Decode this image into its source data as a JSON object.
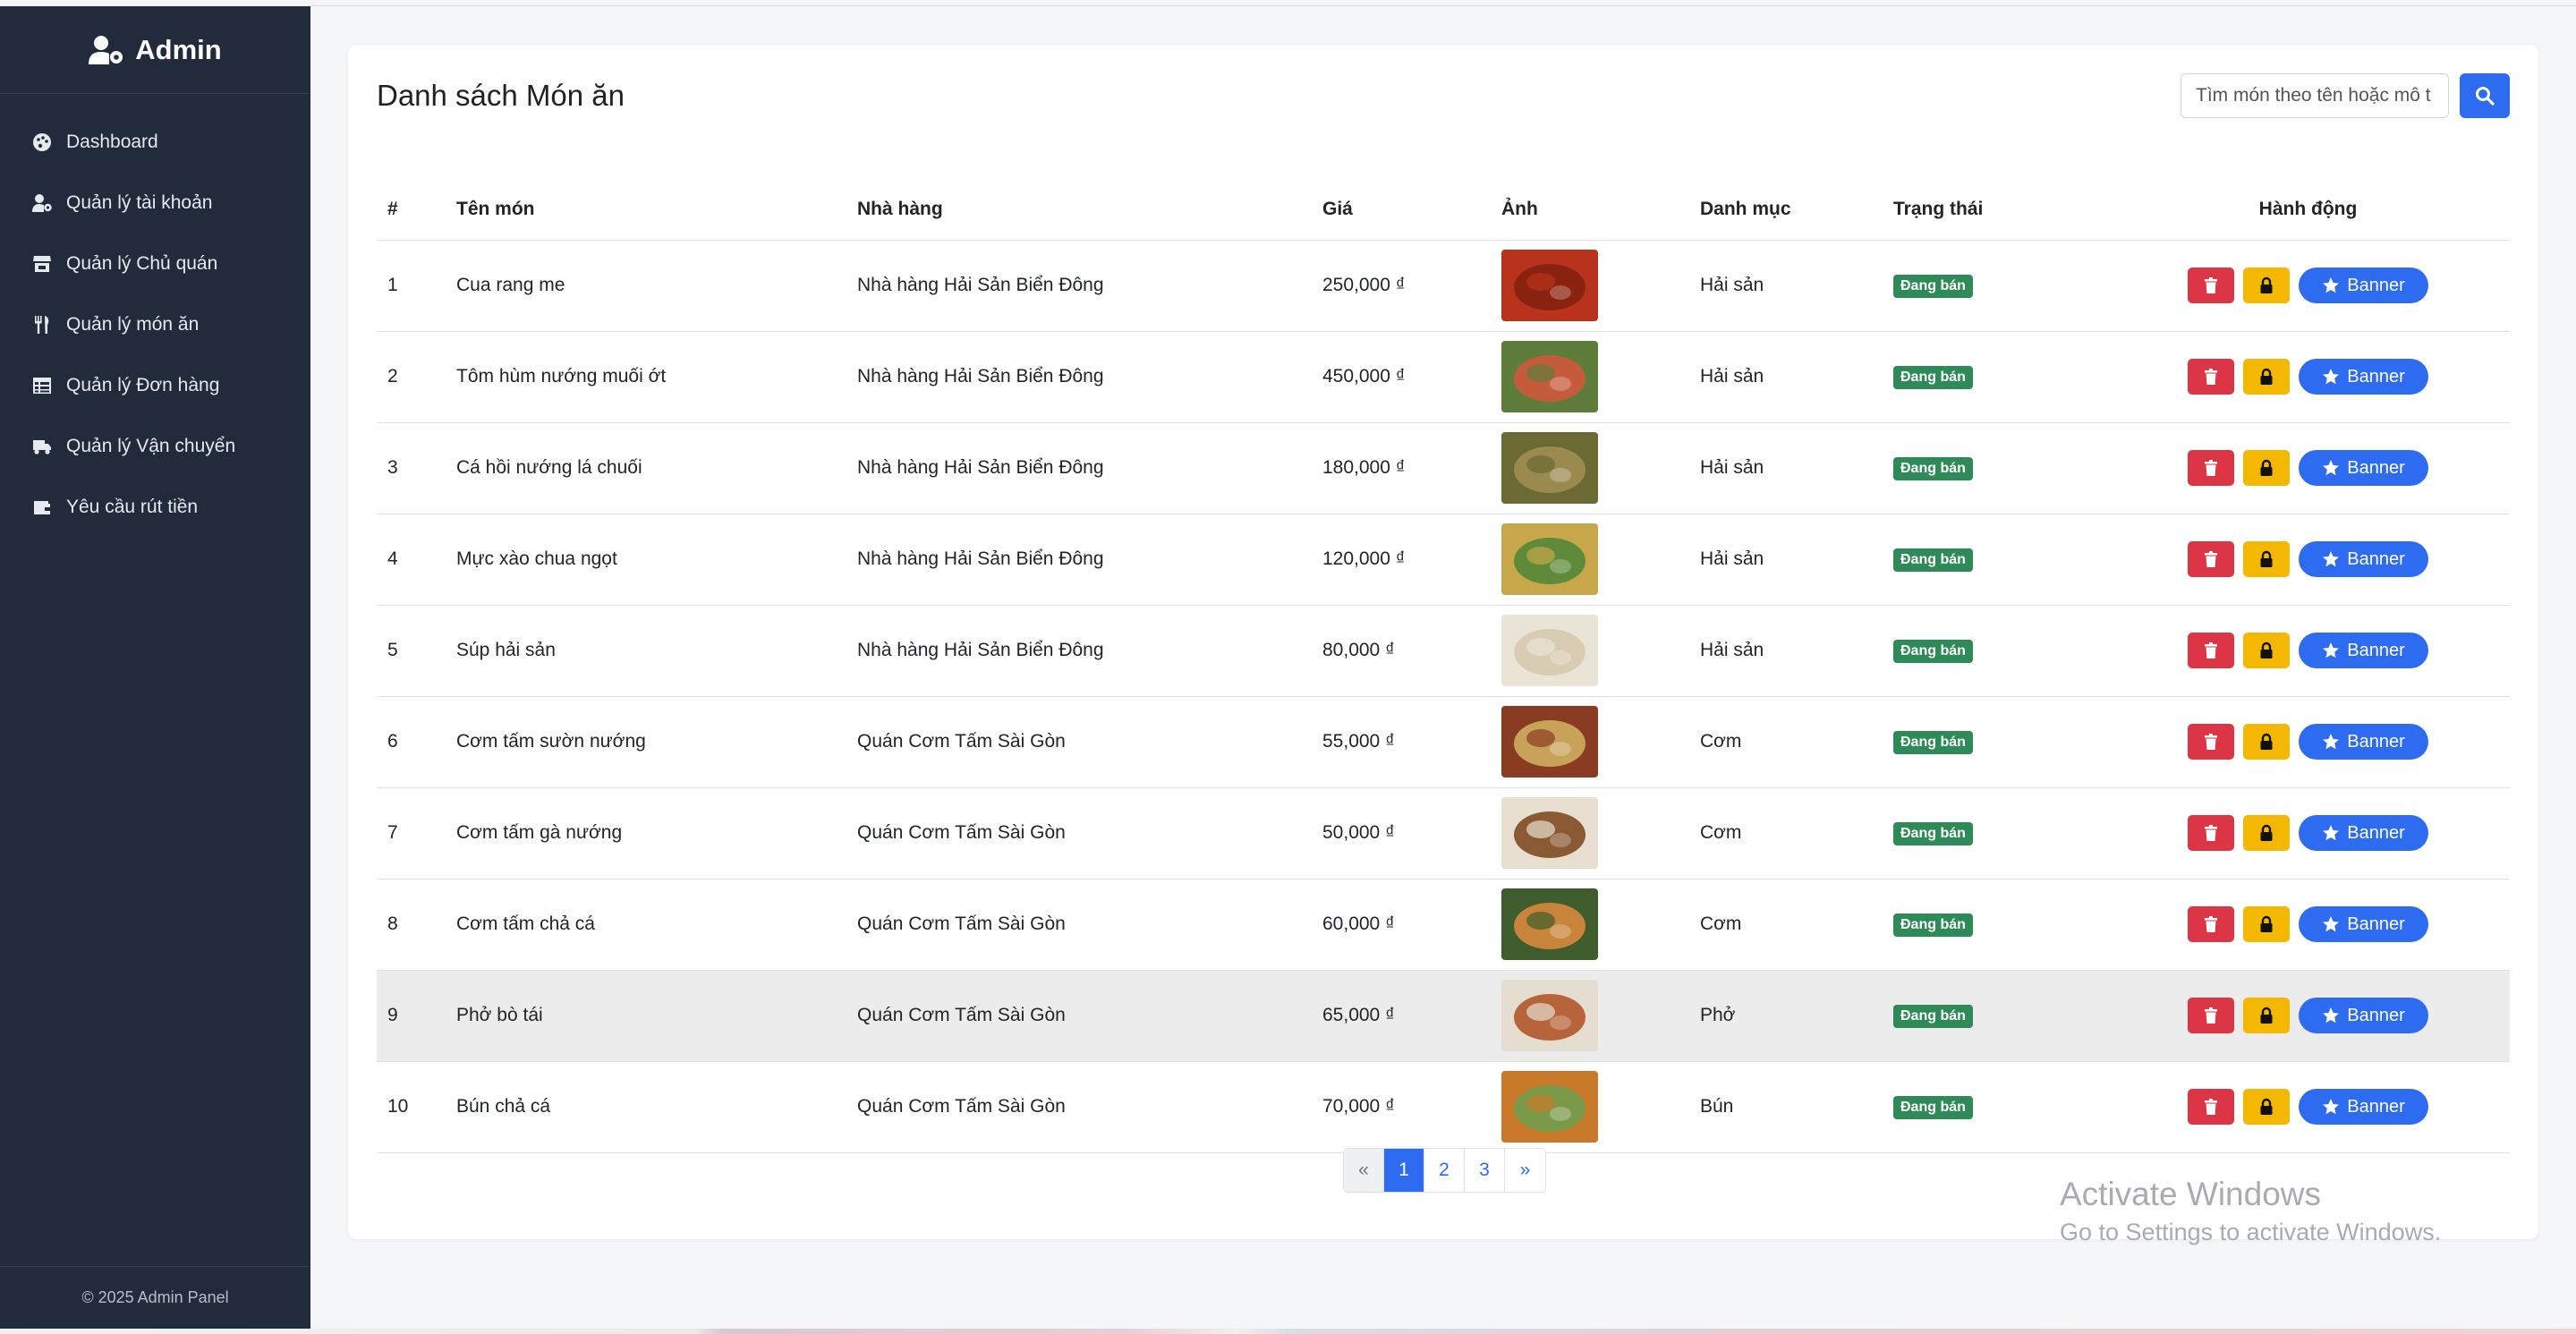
{
  "sidebar": {
    "brand": "Admin",
    "items": [
      {
        "label": "Dashboard",
        "icon": "palette-icon"
      },
      {
        "label": "Quản lý tài khoản",
        "icon": "user-gear-icon"
      },
      {
        "label": "Quản lý Chủ quán",
        "icon": "store-icon"
      },
      {
        "label": "Quản lý món ăn",
        "icon": "utensils-icon"
      },
      {
        "label": "Quản lý Đơn hàng",
        "icon": "table-list-icon"
      },
      {
        "label": "Quản lý Vận chuyển",
        "icon": "truck-icon"
      },
      {
        "label": "Yêu cầu rút tiền",
        "icon": "wallet-icon"
      }
    ],
    "footer": "© 2025 Admin Panel"
  },
  "main": {
    "title": "Danh sách Món ăn",
    "search_placeholder": "Tìm món theo tên hoặc mô t",
    "columns": [
      "#",
      "Tên món",
      "Nhà hàng",
      "Giá",
      "Ảnh",
      "Danh mục",
      "Trạng thái",
      "Hành động"
    ],
    "rows": [
      {
        "no": "1",
        "name": "Cua rang me",
        "restaurant": "Nhà hàng Hải Sản Biển Đông",
        "price": "250,000 ₫",
        "category": "Hải sản",
        "status": "Đang bán"
      },
      {
        "no": "2",
        "name": "Tôm hùm nướng muối ớt",
        "restaurant": "Nhà hàng Hải Sản Biển Đông",
        "price": "450,000 ₫",
        "category": "Hải sản",
        "status": "Đang bán"
      },
      {
        "no": "3",
        "name": "Cá hồi nướng lá chuối",
        "restaurant": "Nhà hàng Hải Sản Biển Đông",
        "price": "180,000 ₫",
        "category": "Hải sản",
        "status": "Đang bán"
      },
      {
        "no": "4",
        "name": "Mực xào chua ngọt",
        "restaurant": "Nhà hàng Hải Sản Biển Đông",
        "price": "120,000 ₫",
        "category": "Hải sản",
        "status": "Đang bán"
      },
      {
        "no": "5",
        "name": "Súp hải sản",
        "restaurant": "Nhà hàng Hải Sản Biển Đông",
        "price": "80,000 ₫",
        "category": "Hải sản",
        "status": "Đang bán"
      },
      {
        "no": "6",
        "name": "Cơm tấm sườn nướng",
        "restaurant": "Quán Cơm Tấm Sài Gòn",
        "price": "55,000 ₫",
        "category": "Cơm",
        "status": "Đang bán"
      },
      {
        "no": "7",
        "name": "Cơm tấm gà nướng",
        "restaurant": "Quán Cơm Tấm Sài Gòn",
        "price": "50,000 ₫",
        "category": "Cơm",
        "status": "Đang bán"
      },
      {
        "no": "8",
        "name": "Cơm tấm chả cá",
        "restaurant": "Quán Cơm Tấm Sài Gòn",
        "price": "60,000 ₫",
        "category": "Cơm",
        "status": "Đang bán"
      },
      {
        "no": "9",
        "name": "Phở bò tái",
        "restaurant": "Quán Cơm Tấm Sài Gòn",
        "price": "65,000 ₫",
        "category": "Phở",
        "status": "Đang bán"
      },
      {
        "no": "10",
        "name": "Bún chả cá",
        "restaurant": "Quán Cơm Tấm Sài Gòn",
        "price": "70,000 ₫",
        "category": "Bún",
        "status": "Đang bán"
      }
    ],
    "banner_label": "Banner",
    "pagination": [
      "«",
      "1",
      "2",
      "3",
      "»"
    ]
  },
  "watermark": {
    "line1": "Activate Windows",
    "line2": "Go to Settings to activate Windows."
  },
  "colors": {
    "sidebar_bg": "#212b3b",
    "primary": "#2d6cf0",
    "danger": "#dc3545",
    "warning": "#f5b800",
    "success": "#2e8b57"
  }
}
